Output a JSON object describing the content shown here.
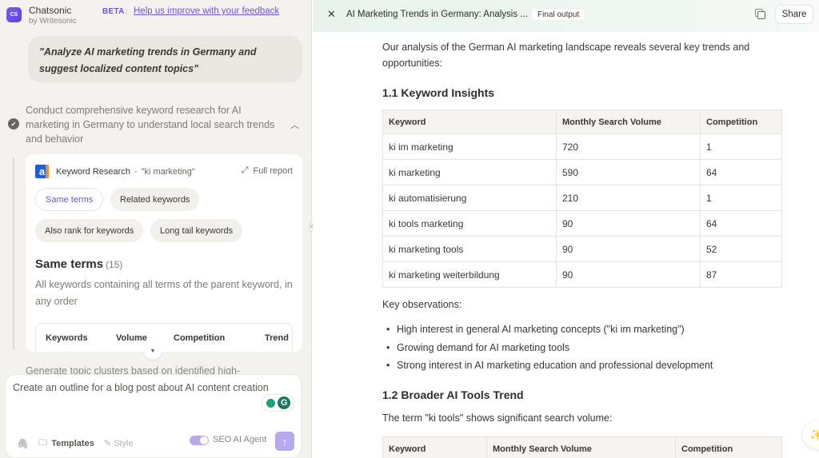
{
  "app": {
    "logo_text": "CS",
    "name": "Chatsonic",
    "by": "by Writesonic",
    "beta_label": "BETA",
    "feedback_link": "Help us improve with your feedback"
  },
  "chat": {
    "user_prompt": "\"Analyze AI marketing trends in Germany and suggest localized content topics\"",
    "step": {
      "text": "Conduct comprehensive keyword research for AI marketing in Germany to understand local search trends and behavior",
      "status": "completed"
    },
    "keyword_card": {
      "logo_text": "a",
      "title": "Keyword Research",
      "dash": "-",
      "query": "\"ki marketing\"",
      "full_report": "Full report",
      "chips": [
        {
          "label": "Same terms",
          "active": true
        },
        {
          "label": "Related keywords",
          "active": false
        },
        {
          "label": "Also rank for keywords",
          "active": false
        },
        {
          "label": "Long tail keywords",
          "active": false
        }
      ],
      "section_title": "Same terms",
      "section_count": "(15)",
      "section_desc": "All keywords containing all terms of the parent keyword, in any order",
      "table_headers": [
        "Keywords",
        "Volume",
        "Competition",
        "Trend"
      ]
    },
    "next_step_text": "Generate topic clusters based on identified high-"
  },
  "composer": {
    "input_value": "Create an outline for a blog post about AI content creation",
    "grammarly_label": "G",
    "templates_label": "Templates",
    "style_label": "Style",
    "seo_agent_label": "SEO AI Agent",
    "seo_agent_enabled": true
  },
  "document": {
    "title": "AI Marketing Trends in Germany: Analysis ...",
    "badge": "Final output",
    "share_label": "Share",
    "intro": "Our analysis of the German AI marketing landscape reveals several key trends and opportunities:",
    "section1": {
      "heading": "1.1 Keyword Insights",
      "headers": [
        "Keyword",
        "Monthly Search Volume",
        "Competition"
      ],
      "rows": [
        [
          "ki im marketing",
          "720",
          "1"
        ],
        [
          "ki marketing",
          "590",
          "64"
        ],
        [
          "ki automatisierung",
          "210",
          "1"
        ],
        [
          "ki tools marketing",
          "90",
          "64"
        ],
        [
          "ki marketing tools",
          "90",
          "52"
        ],
        [
          "ki marketing weiterbildung",
          "90",
          "87"
        ]
      ]
    },
    "observations_label": "Key observations:",
    "observations": [
      "High interest in general AI marketing concepts (\"ki im marketing\")",
      "Growing demand for AI marketing tools",
      "Strong interest in AI marketing education and professional development"
    ],
    "section2": {
      "heading": "1.2 Broader AI Tools Trend",
      "text": "The term \"ki tools\" shows significant search volume:",
      "headers": [
        "Keyword",
        "Monthly Search Volume",
        "Competition"
      ]
    }
  },
  "colors": {
    "accent": "#6b55d6",
    "left_bg": "#f3f2ee",
    "topbar_bg": "#e7f3ec"
  }
}
